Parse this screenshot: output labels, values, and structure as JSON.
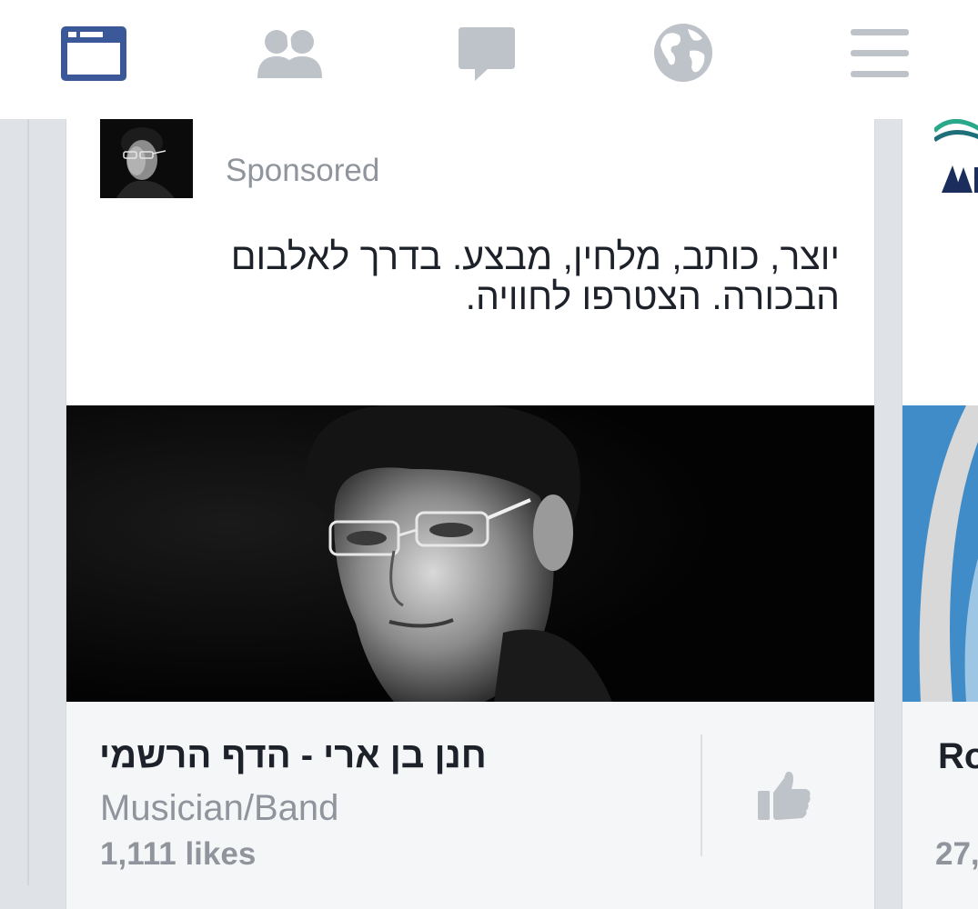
{
  "nav": {
    "items": [
      {
        "name": "news-feed",
        "active": true
      },
      {
        "name": "friend-requests",
        "active": false
      },
      {
        "name": "messages",
        "active": false
      },
      {
        "name": "notifications",
        "active": false
      },
      {
        "name": "more-menu",
        "active": false
      }
    ],
    "active_color": "#3b5998",
    "inactive_color": "#bec2c9"
  },
  "ad_card": {
    "sponsored_label": "Sponsored",
    "body_text_line1": "יוצר, כותב, מלחין, מבצע. בדרך לאלבום",
    "body_text_line2": "הבכורה. הצטרפו לחוויה.",
    "page_name": "חנן בן ארי - הדף הרשמי",
    "page_category": "Musician/Band",
    "page_likes": "1,111 likes"
  },
  "next_card": {
    "title_partial": "Ro",
    "likes_partial": "27,"
  }
}
